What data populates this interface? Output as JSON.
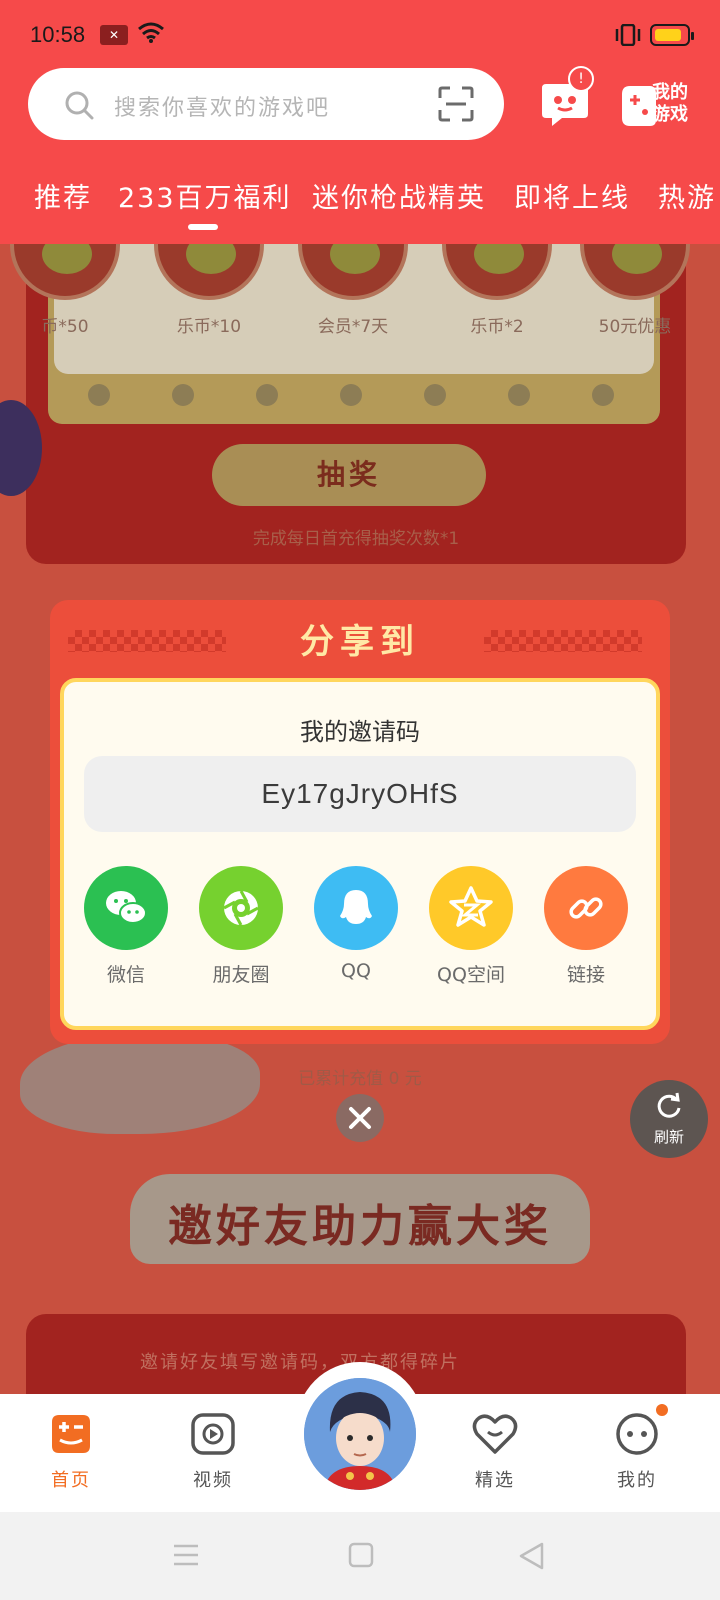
{
  "status_bar": {
    "time": "10:58"
  },
  "header": {
    "search_placeholder": "搜索你喜欢的游戏吧",
    "message_badge": "!",
    "my_games_label": "我的游戏"
  },
  "tabs": [
    {
      "label": "推荐",
      "active": false
    },
    {
      "label": "233百万福利",
      "active": true
    },
    {
      "label": "迷你枪战精英",
      "active": false
    },
    {
      "label": "即将上线",
      "active": false
    },
    {
      "label": "热游",
      "active": false
    }
  ],
  "background": {
    "prizes": [
      {
        "label": "币*50"
      },
      {
        "label": "乐币*10"
      },
      {
        "label": "会员*7天"
      },
      {
        "label": "乐币*2"
      },
      {
        "label": "50元优惠"
      }
    ],
    "draw_button": "抽奖",
    "draw_note": "完成每日首充得抽奖次数*1",
    "accumulated": "已累计充值 0 元",
    "refresh_label": "刷新",
    "invite_title": "邀好友助力赢大奖",
    "invite_card_text": "邀请好友填写邀请码，双方都得碎片"
  },
  "share_dialog": {
    "title": "分享到",
    "code_label": "我的邀请码",
    "code_value": "Ey17gJryOHfS",
    "targets": [
      {
        "label": "微信",
        "icon": "wechat-icon",
        "color": "#2bc052"
      },
      {
        "label": "朋友圈",
        "icon": "moments-icon",
        "color": "#76d12f"
      },
      {
        "label": "QQ",
        "icon": "qq-icon",
        "color": "#3ebcf3"
      },
      {
        "label": "QQ空间",
        "icon": "qzone-icon",
        "color": "#ffc929"
      },
      {
        "label": "链接",
        "icon": "link-icon",
        "color": "#ff7a3f"
      }
    ]
  },
  "bottom_nav": [
    {
      "label": "首页",
      "icon": "home-gamepad-icon",
      "active": true
    },
    {
      "label": "视频",
      "icon": "video-icon",
      "active": false
    },
    {
      "label": "精选",
      "icon": "heart-icon",
      "active": false
    },
    {
      "label": "我的",
      "icon": "profile-icon",
      "active": false
    }
  ],
  "colors": {
    "brand_red": "#f64a4a",
    "active_orange": "#f26d22"
  }
}
